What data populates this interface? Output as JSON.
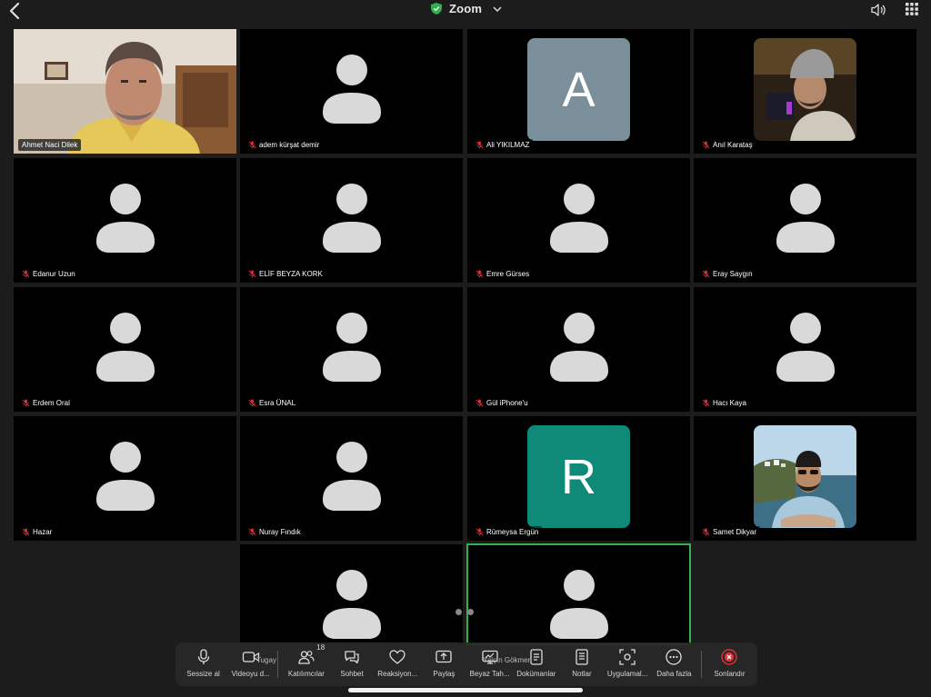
{
  "header": {
    "title": "Zoom"
  },
  "participants": [
    {
      "name": "Ahmet Naci Dilek",
      "type": "photo-man",
      "muted": false
    },
    {
      "name": "adem kürşat demir",
      "type": "placeholder",
      "muted": true
    },
    {
      "name": "Ali YIKILMAZ",
      "type": "letter",
      "letter": "A",
      "color": "#7a8f99",
      "muted": true
    },
    {
      "name": "Anıl Karataş",
      "type": "photo-beanie",
      "muted": true
    },
    {
      "name": "Edanur Uzun",
      "type": "placeholder",
      "muted": true
    },
    {
      "name": "ELİF BEYZA KORK",
      "type": "placeholder",
      "muted": true
    },
    {
      "name": "Emre Gürses",
      "type": "placeholder",
      "muted": true
    },
    {
      "name": "Eray Saygın",
      "type": "placeholder",
      "muted": true
    },
    {
      "name": "Erdem Oral",
      "type": "placeholder",
      "muted": true
    },
    {
      "name": "Esra ÜNAL",
      "type": "placeholder",
      "muted": true
    },
    {
      "name": "Gül iPhone'u",
      "type": "placeholder",
      "muted": true
    },
    {
      "name": "Hacı Kaya",
      "type": "placeholder",
      "muted": true
    },
    {
      "name": "Hazar",
      "type": "placeholder",
      "muted": true
    },
    {
      "name": "Nuray Fındık",
      "type": "placeholder",
      "muted": true
    },
    {
      "name": "Rümeysa Ergün",
      "type": "letter",
      "letter": "R",
      "color": "#0f8a78",
      "muted": true
    },
    {
      "name": "Samet Dikyar",
      "type": "photo-sea",
      "muted": true
    },
    {
      "name": "Tugay",
      "type": "placeholder",
      "muted": true
    },
    {
      "name": "Yalçın Gökmen",
      "type": "placeholder",
      "muted": true,
      "active": true
    }
  ],
  "toolbar": {
    "mute": "Sessize al",
    "video": "Videoyu d...",
    "participants": "Katılımcılar",
    "participants_count": "18",
    "chat": "Sohbet",
    "reactions": "Reaksiyon...",
    "share": "Paylaş",
    "whiteboard": "Beyaz Tah...",
    "docs": "Dokümanlar",
    "notes": "Notlar",
    "apps": "Uygulamal...",
    "more": "Daha fazla",
    "end": "Sonlandır"
  },
  "colors": {
    "accent": "#2fb24c",
    "end": "#e0303a",
    "muted": "#e0303a"
  }
}
